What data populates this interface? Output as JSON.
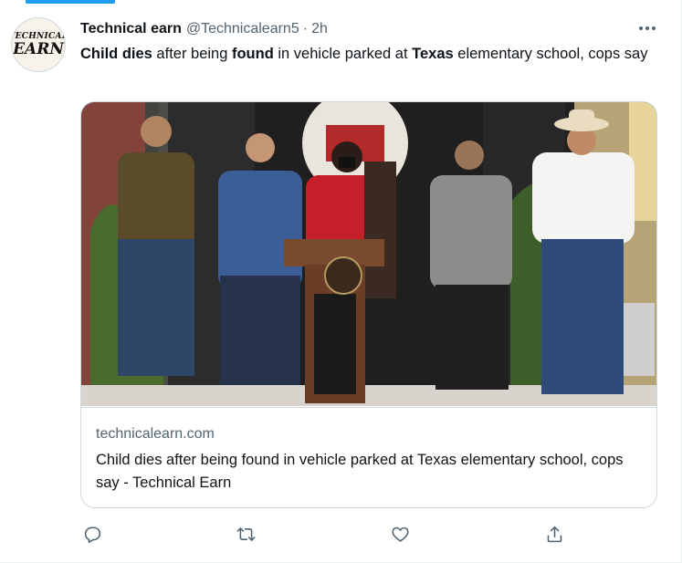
{
  "tweet": {
    "author": {
      "name": "Technical earn",
      "handle": "@Technicalearn5",
      "separator": "·",
      "time": "2h",
      "avatar_text_line1": "TECHNICAL",
      "avatar_text_line2": "EARN"
    },
    "text_segments": [
      {
        "text": "Child dies",
        "bold": true
      },
      {
        "text": " after being ",
        "bold": false
      },
      {
        "text": "found",
        "bold": true
      },
      {
        "text": " in vehicle parked at ",
        "bold": false
      },
      {
        "text": "Texas",
        "bold": true
      },
      {
        "text": " elementary school, cops say",
        "bold": false
      }
    ],
    "card": {
      "domain": "technicalearn.com",
      "title": "Child dies after being found in vehicle parked at Texas elementary school, cops say - Technical Earn"
    },
    "actions": [
      {
        "name": "reply-icon"
      },
      {
        "name": "retweet-icon"
      },
      {
        "name": "like-icon"
      },
      {
        "name": "share-icon"
      }
    ]
  },
  "colors": {
    "accent": "#1d9bf0",
    "text_primary": "#0f1419",
    "text_secondary": "#536471",
    "border": "#cfd9de"
  }
}
